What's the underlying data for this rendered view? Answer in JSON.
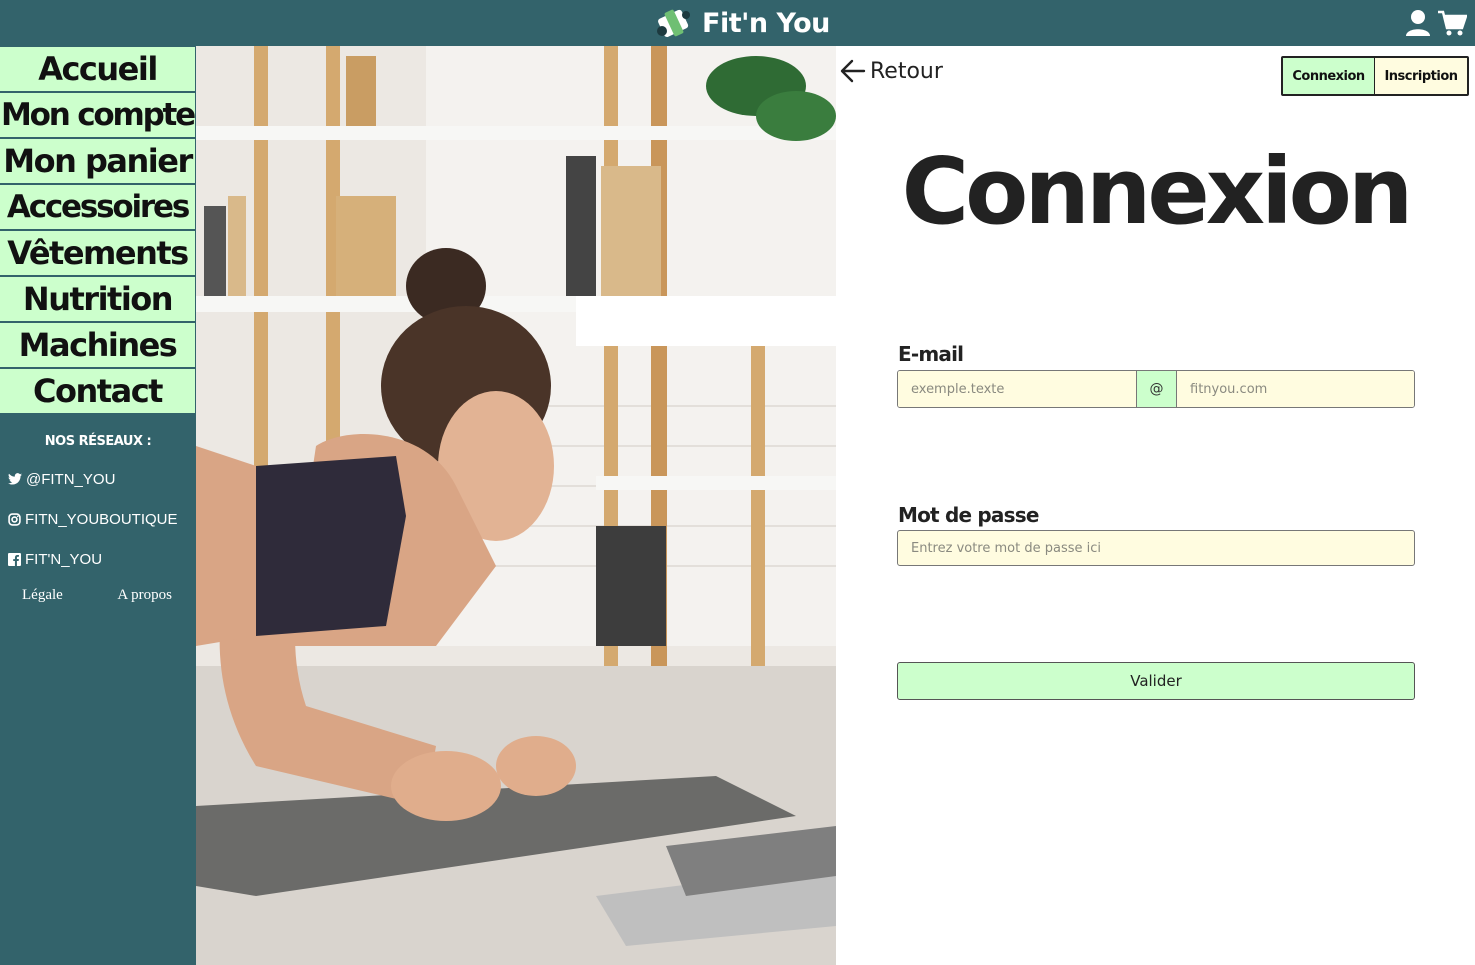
{
  "header": {
    "brand": "Fit'n You",
    "logo_icon": "dumbbell-icon",
    "account_icon": "user-icon",
    "cart_icon": "cart-icon"
  },
  "sidebar": {
    "nav": [
      {
        "label": "Accueil"
      },
      {
        "label": "Mon compte"
      },
      {
        "label": "Mon panier"
      },
      {
        "label": "Accessoires"
      },
      {
        "label": "Vêtements"
      },
      {
        "label": "Nutrition"
      },
      {
        "label": "Machines"
      },
      {
        "label": "Contact"
      }
    ],
    "networks_title": "NOS RÉSEAUX :",
    "social": [
      {
        "icon": "twitter-icon",
        "label": "@FITN_YOU"
      },
      {
        "icon": "instagram-icon",
        "label": "FITN_YOUBOUTIQUE"
      },
      {
        "icon": "facebook-icon",
        "label": "FIT'N_YOU"
      }
    ],
    "footer": {
      "legal": "Légale",
      "about": "A propos"
    }
  },
  "main": {
    "back_label": "Retour",
    "back_icon": "arrow-left-icon",
    "tabs": [
      {
        "label": "Connexion",
        "active": true
      },
      {
        "label": "Inscription",
        "active": false
      }
    ],
    "title": "Connexion",
    "email": {
      "label": "E-mail",
      "user_placeholder": "exemple.texte",
      "at": "@",
      "domain_placeholder": "fitnyou.com"
    },
    "password": {
      "label": "Mot de passe",
      "placeholder": "Entrez votre mot de passe ici"
    },
    "submit_label": "Valider"
  },
  "colors": {
    "teal": "#33636b",
    "mint": "#ccffcc",
    "cream": "#fffce0"
  }
}
